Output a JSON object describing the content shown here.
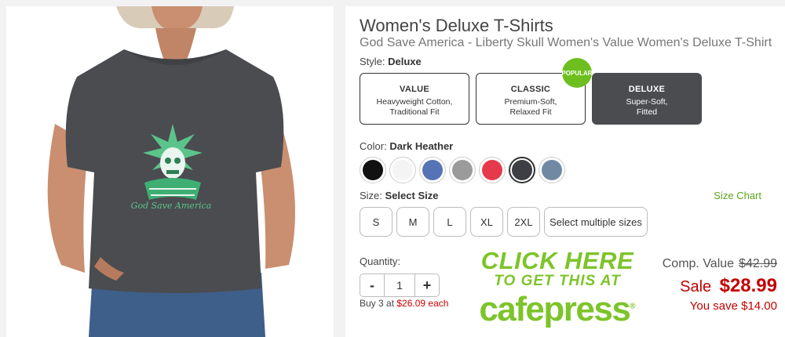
{
  "product": {
    "title": "Women's Deluxe T-Shirts",
    "subtitle": "God Save America - Liberty Skull Women's Value Women's Deluxe T-Shirt",
    "graphic_caption": "God Save America"
  },
  "style": {
    "label": "Style:",
    "selected": "Deluxe",
    "options": [
      {
        "name": "VALUE",
        "line1": "Heavyweight Cotton,",
        "line2": "Traditional Fit"
      },
      {
        "name": "CLASSIC",
        "line1": "Premium-Soft,",
        "line2": "Relaxed Fit"
      },
      {
        "name": "DELUXE",
        "line1": "Super-Soft,",
        "line2": "Fitted"
      }
    ],
    "popular_badge": "POPULAR"
  },
  "color": {
    "label": "Color:",
    "selected": "Dark Heather",
    "swatches": [
      {
        "name": "black",
        "hex": "#111111"
      },
      {
        "name": "white",
        "hex": "#f4f4f4"
      },
      {
        "name": "blue",
        "hex": "#5573b5"
      },
      {
        "name": "gray",
        "hex": "#9b9b9b"
      },
      {
        "name": "red",
        "hex": "#e53a4b"
      },
      {
        "name": "dark-heather",
        "hex": "#3d3f44"
      },
      {
        "name": "slate",
        "hex": "#7189a3"
      }
    ]
  },
  "size": {
    "label": "Size:",
    "selected": "Select Size",
    "chart_link": "Size Chart",
    "options": [
      "S",
      "M",
      "L",
      "XL",
      "2XL",
      "Select multiple sizes"
    ]
  },
  "quantity": {
    "label": "Quantity:",
    "value": "1",
    "minus": "-",
    "plus": "+",
    "bulk_prefix": "Buy 3 at",
    "bulk_price": "$26.09 each"
  },
  "pricing": {
    "comp_label": "Comp. Value",
    "comp_price": "$42.99",
    "sale_label": "Sale",
    "sale_price": "$28.99",
    "savings": "You save $14.00"
  },
  "promo": {
    "line1": "CLICK HERE",
    "line2": "TO GET THIS AT",
    "brand": "cafepress",
    "mark": "®"
  },
  "colors": {
    "accent_green": "#7dc42a",
    "price_red": "#c40000",
    "selected_dark": "#4a4c50"
  }
}
